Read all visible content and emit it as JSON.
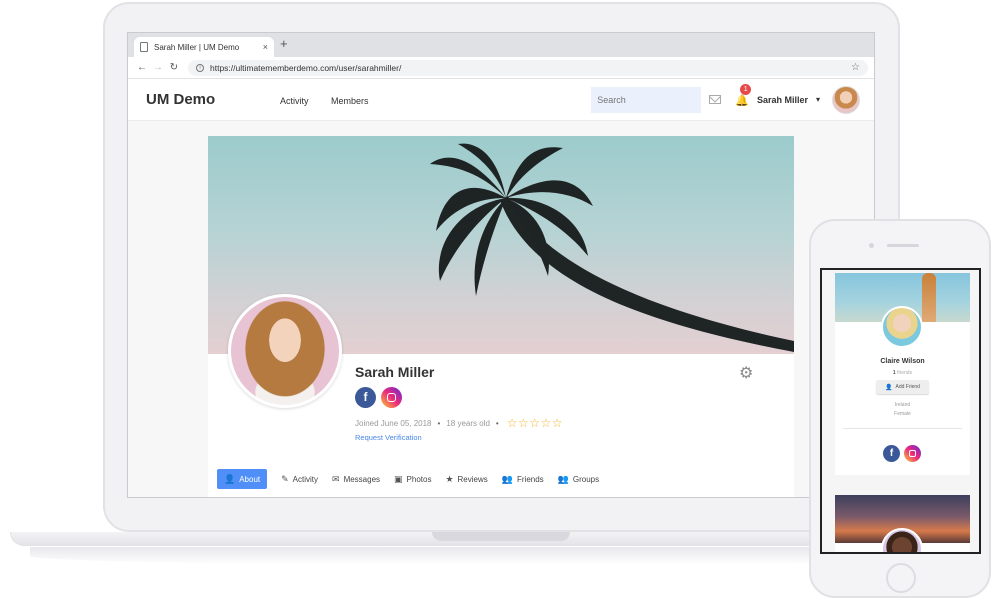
{
  "browser": {
    "tab_title": "Sarah Miller | UM Demo",
    "tab_close": "×",
    "new_tab": "+",
    "url": "https://ultimatememberdemo.com/user/sarahmiller/"
  },
  "site": {
    "logo": "UM Demo",
    "nav": [
      "Activity",
      "Members"
    ],
    "search_placeholder": "Search",
    "notification_count": "1",
    "user_name": "Sarah Miller"
  },
  "profile": {
    "name": "Sarah Miller",
    "joined": "Joined June 05, 2018",
    "age": "18 years old",
    "rating": {
      "value": 0,
      "max": 5,
      "stars": "☆☆☆☆☆"
    },
    "verify_link": "Request Verification",
    "tabs": [
      {
        "label": "About",
        "icon": "user-icon",
        "glyph": "👤",
        "active": true
      },
      {
        "label": "Activity",
        "icon": "edit-icon",
        "glyph": "✎",
        "active": false
      },
      {
        "label": "Messages",
        "icon": "envelope-icon",
        "glyph": "✉",
        "active": false
      },
      {
        "label": "Photos",
        "icon": "image-icon",
        "glyph": "▣",
        "active": false
      },
      {
        "label": "Reviews",
        "icon": "star-icon",
        "glyph": "★",
        "active": false
      },
      {
        "label": "Friends",
        "icon": "users-icon",
        "glyph": "👥",
        "active": false
      },
      {
        "label": "Groups",
        "icon": "group-icon",
        "glyph": "👥",
        "active": false
      }
    ]
  },
  "mobile": {
    "name": "Claire Wilson",
    "friends_count": "1",
    "friends_label": "friends",
    "add_friend": "Add Friend",
    "location": "Ireland",
    "gender": "Female"
  },
  "colors": {
    "accent": "#4f8ff7",
    "facebook": "#3b5998",
    "notification": "#e64a4a",
    "stars": "#f0b429"
  }
}
